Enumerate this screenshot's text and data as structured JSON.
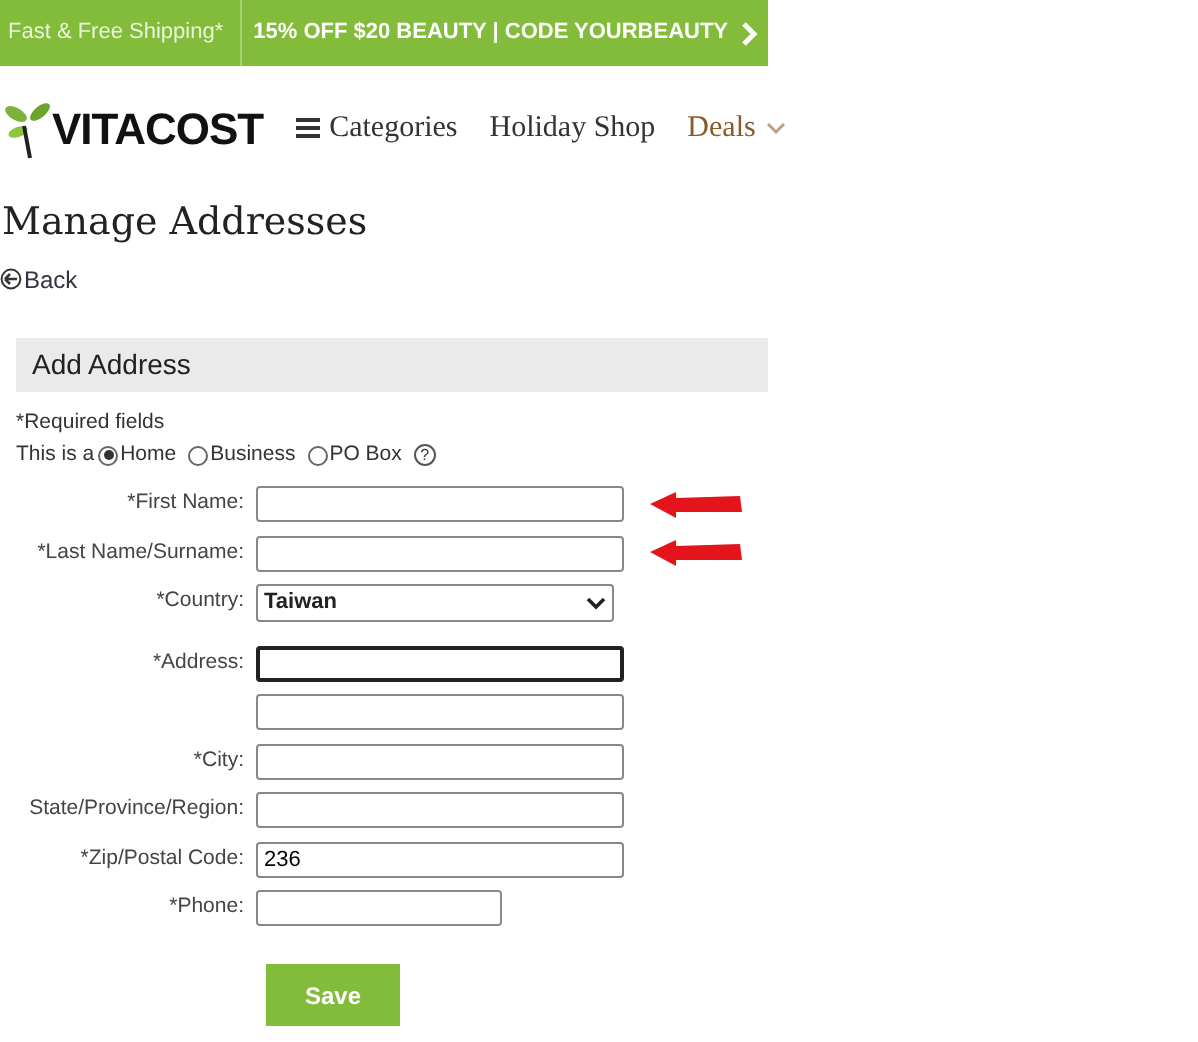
{
  "promo_bar": {
    "shipping": "Fast & Free Shipping*",
    "offer": "15% OFF $20 BEAUTY | CODE YOURBEAUTY"
  },
  "header": {
    "logo": "VITACOST",
    "nav": [
      {
        "label": "Categories",
        "kind": "menu"
      },
      {
        "label": "Holiday Shop",
        "kind": "link"
      },
      {
        "label": "Deals",
        "kind": "dropdown"
      }
    ]
  },
  "page_title": "Manage Addresses",
  "back_link": "Back",
  "section_title": "Add Address",
  "required_note": "*Required fields",
  "address_type": {
    "label": "This is a",
    "help": "?",
    "options": [
      {
        "label": "Home",
        "selected": true
      },
      {
        "label": "Business",
        "selected": false
      },
      {
        "label": "PO Box",
        "selected": false
      }
    ]
  },
  "fields": [
    {
      "label": "*First Name:",
      "kind": "text",
      "marked": true,
      "focused": false
    },
    {
      "label": "*Last Name/Surname:",
      "kind": "text",
      "marked": true,
      "focused": false
    },
    {
      "label": "*Country:",
      "kind": "select",
      "value": "Taiwan",
      "marked": false,
      "focused": false
    },
    {
      "label": "*Address:",
      "kind": "text",
      "marked": false,
      "focused": true
    },
    {
      "kind": "text",
      "marked": false,
      "focused": false
    },
    {
      "label": "*City:",
      "kind": "text",
      "marked": false,
      "focused": false
    },
    {
      "label": "State/Province/Region:",
      "kind": "text",
      "marked": false,
      "focused": false
    },
    {
      "label": "*Zip/Postal Code:",
      "kind": "text",
      "value": "236",
      "marked": false,
      "focused": false
    },
    {
      "label": "*Phone:",
      "kind": "phone",
      "marked": false,
      "focused": false
    }
  ],
  "save_button": "Save"
}
